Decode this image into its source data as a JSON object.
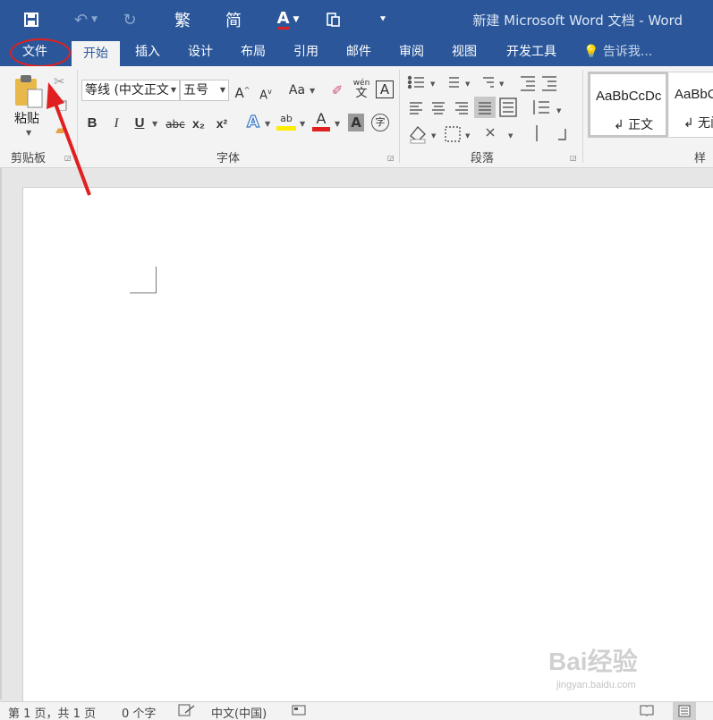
{
  "window": {
    "title": "新建 Microsoft Word 文档 - Word"
  },
  "qat": {
    "save_icon": "save-icon",
    "undo_icon": "undo-icon",
    "redo_icon": "redo-icon",
    "trad_label": "繁",
    "simp_label": "简",
    "font_color_label": "A",
    "customize_icon": "customize-icon"
  },
  "tabs": [
    "文件",
    "开始",
    "插入",
    "设计",
    "布局",
    "引用",
    "邮件",
    "审阅",
    "视图",
    "开发工具"
  ],
  "active_tab": "开始",
  "tell_me": "告诉我...",
  "clipboard": {
    "paste_label": "粘贴",
    "group_label": "剪贴板"
  },
  "font": {
    "font_name": "等线 (中文正文",
    "font_size": "五号",
    "group_label": "字体",
    "grow": "A",
    "shrink": "A",
    "case": "Aa",
    "phonetic": "wén",
    "phonetic_char": "文",
    "border_char": "A",
    "bold": "B",
    "italic": "I",
    "underline": "U",
    "strike": "abc",
    "subscript": "x₂",
    "superscript": "x²",
    "effects": "A",
    "highlight": "ab",
    "color": "A",
    "shading": "A",
    "enclose": "字"
  },
  "paragraph": {
    "group_label": "段落"
  },
  "styles": {
    "group_label": "样式",
    "items": [
      {
        "sample": "AaBbCcDc",
        "name": "↲ 正文"
      },
      {
        "sample": "AaBbC",
        "name": "↲ 无间"
      }
    ]
  },
  "status": {
    "page": "第 1 页，共 1 页",
    "words": "0 个字",
    "language": "中文(中国)"
  },
  "watermark": {
    "brand": "Bai经验",
    "url": "jingyan.baidu.com"
  },
  "colors": {
    "accent": "#2b579a",
    "annotation": "#e02020"
  }
}
